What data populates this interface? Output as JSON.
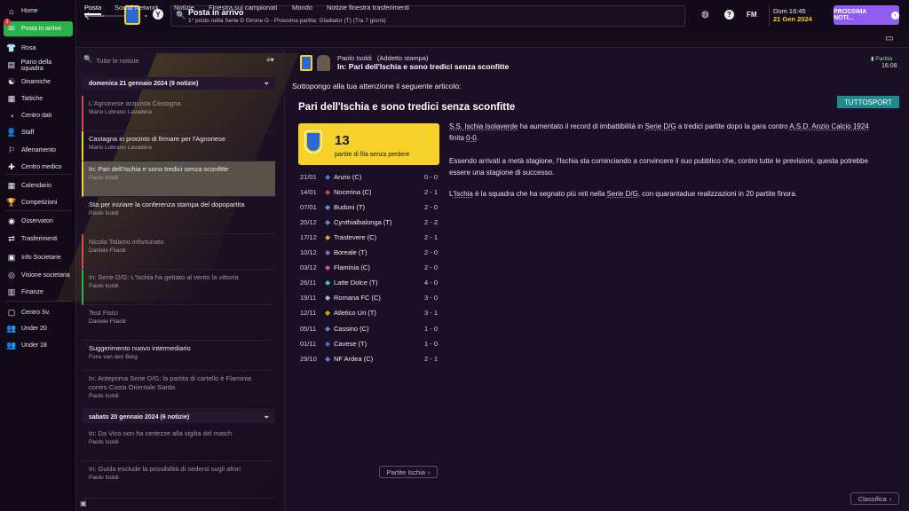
{
  "sidebar": {
    "items": [
      {
        "label": "Home",
        "icon": "home-icon",
        "glyph": "⌂"
      },
      {
        "label": "Posta in arrivo",
        "icon": "inbox-icon",
        "glyph": "✉",
        "active": true
      },
      {
        "label": "Rosa",
        "icon": "shirt-icon",
        "glyph": "👕"
      },
      {
        "label": "Piano della squadra",
        "icon": "clipboard-icon",
        "glyph": "▤"
      },
      {
        "label": "Dinamiche",
        "icon": "dynamics-icon",
        "glyph": "☯"
      },
      {
        "label": "Tattiche",
        "icon": "tactics-icon",
        "glyph": "▦"
      },
      {
        "label": "Centro dati",
        "icon": "data-icon",
        "glyph": "◔"
      },
      {
        "label": "Staff",
        "icon": "staff-icon",
        "glyph": "👤"
      },
      {
        "label": "Allenamento",
        "icon": "training-icon",
        "glyph": "⚐"
      },
      {
        "label": "Centro medico",
        "icon": "medical-icon",
        "glyph": "✚"
      },
      {
        "label": "Calendario",
        "icon": "calendar-icon",
        "glyph": "▦"
      },
      {
        "label": "Competizioni",
        "icon": "trophy-icon",
        "glyph": "🏆"
      },
      {
        "label": "Osservatori",
        "icon": "scout-icon",
        "glyph": "◉"
      },
      {
        "label": "Trasferimenti",
        "icon": "transfer-icon",
        "glyph": "⇄"
      },
      {
        "label": "Info Societarie",
        "icon": "club-info-icon",
        "glyph": "▣"
      },
      {
        "label": "Visione societaria",
        "icon": "vision-icon",
        "glyph": "◎"
      },
      {
        "label": "Finanze",
        "icon": "finance-icon",
        "glyph": "▥"
      },
      {
        "label": "Centro Sv.",
        "icon": "development-icon",
        "glyph": "▢"
      },
      {
        "label": "Under 20",
        "icon": "u20-icon",
        "glyph": "👥"
      },
      {
        "label": "Under 18",
        "icon": "u18-icon",
        "glyph": "👥"
      }
    ],
    "badge": "1"
  },
  "topbar": {
    "title": "Posta in arrivo",
    "subtitle": "1° posto nella Serie D Girone G - Prossima partita: Gladiator (T) (Tra 7 giorni)",
    "time": "Dom 16:45",
    "date": "21 Gen 2024",
    "next_label": "PROSSIMA NOTI..."
  },
  "tabs": [
    "Posta",
    "Social Network",
    "Notizie",
    "Finestra sui campionati",
    "Mondo",
    "Notizie finestra trasferimenti"
  ],
  "list": {
    "search_placeholder": "Tutte le notizie",
    "groups": [
      {
        "label": "domenica 21 gennaio 2024 (9 notizie)"
      },
      {
        "label": "sabato 20 gennaio 2024 (6 notizie)"
      }
    ],
    "messages": [
      {
        "title": "L'Agnonese acquista Castagna",
        "sender": "Mario Lubrano Lavadera"
      },
      {
        "title": "Castagna in procinto di firmare per l'Agnonese",
        "sender": "Mario Lubrano Lavadera"
      },
      {
        "title": "In: Pari dell'Ischia e sono tredici senza sconfitte",
        "sender": "Paolo Isoldi"
      },
      {
        "title": "Sta per iniziare la conferenza stampa del dopopartita",
        "sender": "Paolo Isoldi"
      },
      {
        "title": "Nicola Talamo infortunato",
        "sender": "Daniele Filardi"
      },
      {
        "title": "In: Serie D/G: L'Ischia ha gettato al vento la vittoria",
        "sender": "Paolo Isoldi"
      },
      {
        "title": "Test Fisici",
        "sender": "Daniele Filardi"
      },
      {
        "title": "Suggerimento nuovo intermediario",
        "sender": "Fons van den Berg"
      },
      {
        "title": "In: Anteprima Serie D/G: la partita di cartello è Flaminia contro Costa Orientale Sarda",
        "sender": "Paolo Isoldi"
      },
      {
        "title": "In: Da Vico non ha certezze alla vigilia del match",
        "sender": "Paolo Isoldi"
      },
      {
        "title": "In: Guida esclude la possibilità di sedersi sugli allori",
        "sender": "Paolo Isoldi"
      }
    ]
  },
  "message": {
    "sender": "Paolo Isoldi",
    "sender_role": "(Addetto stampa)",
    "subject": "In: Pari dell'Ischia e sono tredici senza sconfitte",
    "tag": "Partita",
    "time": "16:08",
    "intro": "Sottopongo alla tua attenzione il seguente articolo:",
    "source": "TUTTOSPORT",
    "headline": "Pari dell'Ischia e sono tredici senza sconfitte",
    "stat_value": "13",
    "stat_label": "partite di fila senza perdere",
    "results": [
      {
        "date": "21/01",
        "team": "Anzio (C)",
        "score": "0 - 0"
      },
      {
        "date": "14/01",
        "team": "Nocerina (C)",
        "score": "2 - 1"
      },
      {
        "date": "07/01",
        "team": "Budoni (T)",
        "score": "2 - 0"
      },
      {
        "date": "20/12",
        "team": "Cynthialbalonga (T)",
        "score": "2 - 2"
      },
      {
        "date": "17/12",
        "team": "Trastevere (C)",
        "score": "2 - 1"
      },
      {
        "date": "10/12",
        "team": "Boreale (T)",
        "score": "2 - 0"
      },
      {
        "date": "03/12",
        "team": "Flaminia (C)",
        "score": "2 - 0"
      },
      {
        "date": "26/11",
        "team": "Latte Dolce (T)",
        "score": "4 - 0"
      },
      {
        "date": "19/11",
        "team": "Romana FC (C)",
        "score": "3 - 0"
      },
      {
        "date": "12/11",
        "team": "Atletico Uri (T)",
        "score": "3 - 1"
      },
      {
        "date": "05/11",
        "team": "Cassino (C)",
        "score": "1 - 0"
      },
      {
        "date": "01/11",
        "team": "Cavese (T)",
        "score": "1 - 0"
      },
      {
        "date": "29/10",
        "team": "NF Ardea (C)",
        "score": "2 - 1"
      }
    ],
    "para1": "S.S. Ischia Isolaverde ha aumentato il record di imbattibilità in Serie D/G a tredici partite dopo la gara contro A.S.D. Anzio Calcio 1924 finita 0-0.",
    "para2": "Essendo arrivati a metà stagione, l'Ischia sta cominciando a convincere il suo pubblico che, contro tutte le previsioni, questa potrebbe essere una stagione di successo.",
    "para3": "L'Ischia è la squadra che ha segnato più reti nella Serie D/G, con quarantadue realizzazioni in 20 partite finora.",
    "btn_matches": "Partite Ischia",
    "btn_table": "Classifica"
  },
  "colors": {
    "accent": "#8f5cf0",
    "active": "#2bb24a",
    "card": "#f5d12a",
    "source": "#1f8a8f"
  }
}
